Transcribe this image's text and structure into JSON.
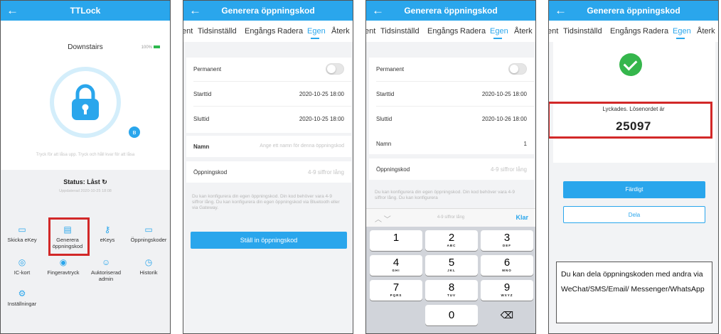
{
  "colors": {
    "accent": "#2aa6ec",
    "highlight": "#d22828",
    "success": "#35b64c"
  },
  "screen1": {
    "title": "TTLock",
    "lock_name": "Downstairs",
    "battery": "100%",
    "hint": "Tryck för att låsa upp. Tryck och håll kvar för att låsa",
    "status_label": "Status:",
    "status_value": "Låst",
    "status_time": "Uppdaterad 2020-10-25 18:08",
    "menu": [
      {
        "label": "Skicka eKey",
        "icon": "send-ekey-icon"
      },
      {
        "label": "Generera öppningskod",
        "icon": "passcode-icon"
      },
      {
        "label": "eKeys",
        "icon": "key-icon"
      },
      {
        "label": "Öppningskoder",
        "icon": "passcode-list-icon"
      },
      {
        "label": "IC-kort",
        "icon": "card-icon"
      },
      {
        "label": "Fingeravtryck",
        "icon": "fingerprint-icon"
      },
      {
        "label": "Auktoriserad admin",
        "icon": "admin-icon"
      },
      {
        "label": "Historik",
        "icon": "history-icon"
      },
      {
        "label": "Inställningar",
        "icon": "settings-icon"
      }
    ]
  },
  "tabs": [
    "ent",
    "Tidsinställd",
    "Engångs",
    "Radera",
    "Egen",
    "Återk"
  ],
  "screen2": {
    "title": "Generera öppningskod",
    "permanent_label": "Permanent",
    "start_label": "Starttid",
    "start_value": "2020-10-25 18:00",
    "end_label": "Sluttid",
    "end_value": "2020-10-25 18:00",
    "name_label": "Namn",
    "name_placeholder": "Ange ett namn för denna öppningskod",
    "code_label": "Öppningskod",
    "code_placeholder": "4-9 siffror lång",
    "description": "Du kan konfigurera din egen öppningskod. Din kod behöver vara 4-9 siffror lång. Du kan konfigurera din egen öppningskod via Bluetooth eller via Gateway.",
    "submit": "Ställ in öppningskod"
  },
  "screen3": {
    "title": "Generera öppningskod",
    "permanent_label": "Permanent",
    "start_label": "Starttid",
    "start_value": "2020-10-25 18:00",
    "end_label": "Sluttid",
    "end_value": "2020-10-26 18:00",
    "name_label": "Namn",
    "name_value": "1",
    "code_label": "Öppningskod",
    "code_placeholder": "4-9 siffror lång",
    "description": "Du kan konfigurera din egen öppningskod. Din kod behöver vara 4-9 siffror lång. Du kan konfigurera",
    "toolbar_hint": "4-9 siffror lång",
    "done": "Klar",
    "keys": [
      {
        "n": "1",
        "l": ""
      },
      {
        "n": "2",
        "l": "ABC"
      },
      {
        "n": "3",
        "l": "DEF"
      },
      {
        "n": "4",
        "l": "GHI"
      },
      {
        "n": "5",
        "l": "JKL"
      },
      {
        "n": "6",
        "l": "MNO"
      },
      {
        "n": "7",
        "l": "PQRS"
      },
      {
        "n": "8",
        "l": "TUV"
      },
      {
        "n": "9",
        "l": "WXYZ"
      },
      {
        "n": "0",
        "l": ""
      }
    ],
    "backspace": "⌫"
  },
  "screen4": {
    "title": "Generera öppningskod",
    "success_text": "Lyckades. Lösenordet är",
    "code": "25097",
    "done_button": "Färdigt",
    "share_button": "Dela",
    "note": "Du kan dela öppningskoden med andra via WeChat/SMS/Email/ Messenger/WhatsApp"
  }
}
